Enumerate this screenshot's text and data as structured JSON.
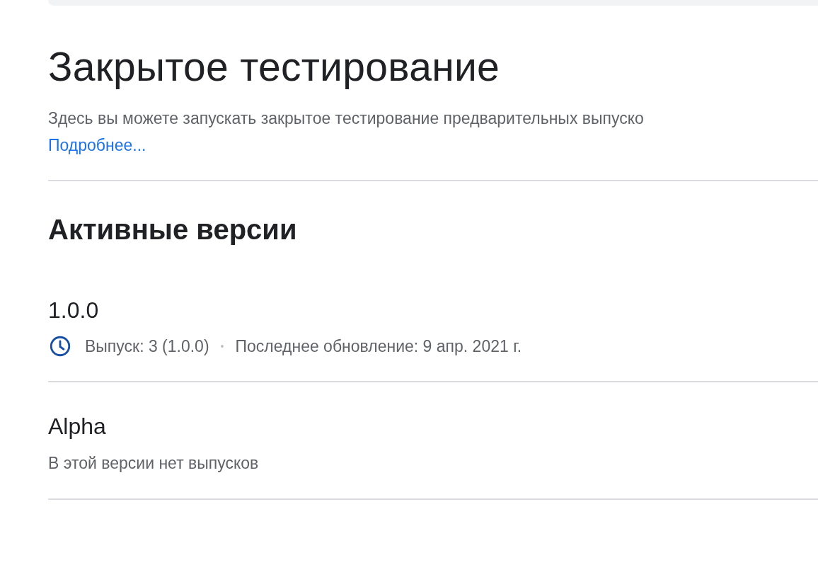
{
  "title": "Закрытое тестирование",
  "description": "Здесь вы можете запускать закрытое тестирование предварительных выпуско",
  "learn_more_link": "Подробнее...",
  "section": {
    "heading": "Активные версии",
    "tracks": [
      {
        "name": "1.0.0",
        "kind": "release",
        "release": "Выпуск: 3 (1.0.0)",
        "separator": "•",
        "updated": "Последнее обновление: 9 апр. 2021 г."
      },
      {
        "name": "Alpha",
        "kind": "empty",
        "note": "В этой версии нет выпусков"
      }
    ]
  }
}
